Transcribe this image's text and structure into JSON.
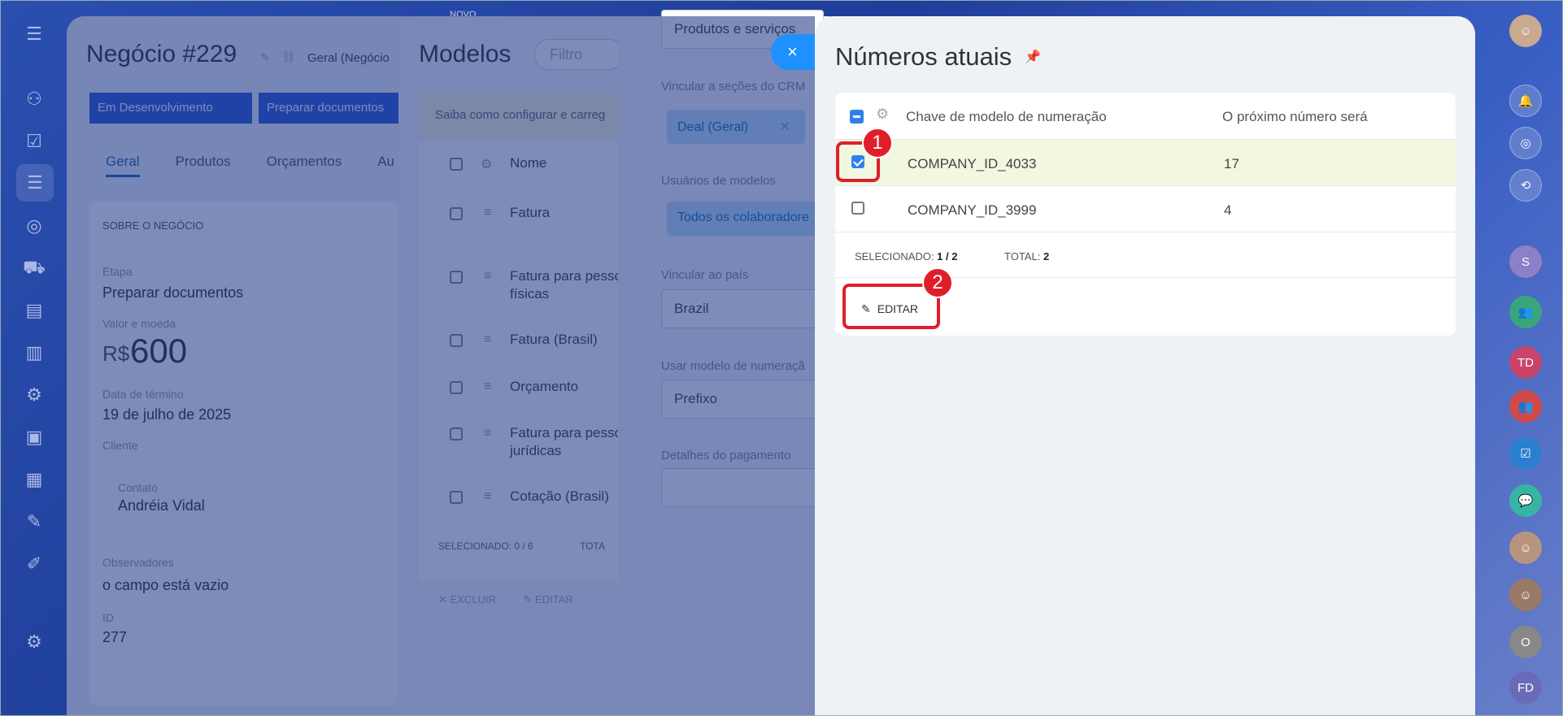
{
  "deal": {
    "title": "Negócio #229",
    "subtitle": "Geral (Negócio",
    "stages": [
      "Em Desenvolvimento",
      "Preparar documentos"
    ],
    "tabs": [
      "Geral",
      "Produtos",
      "Orçamentos",
      "Au"
    ],
    "section": "SOBRE O NEGÓCIO",
    "stage_label": "Etapa",
    "stage_value": "Preparar documentos",
    "amount_label": "Valor e moeda",
    "currency": "R$",
    "amount": "600",
    "end_label": "Data de término",
    "end_value": "19 de julho de 2025",
    "client_label": "Cliente",
    "contact_label": "Contato",
    "contact_value": "Andréia Vidal",
    "observers_label": "Observadores",
    "observers_value": "o campo está vazio",
    "id_label": "ID",
    "id_value": "277"
  },
  "models": {
    "title": "Modelos",
    "filter_placeholder": "Filtro",
    "new_label": "NOVO",
    "hint": "Saiba como configurar e carreg",
    "col_name": "Nome",
    "rows": [
      "Fatura",
      "Fatura para pesso físicas",
      "Fatura (Brasil)",
      "Orçamento",
      "Fatura para pesso jurídicas",
      "Cotação (Brasil)"
    ],
    "footer_selected": "SELECIONADO: 0 / 6",
    "footer_total": "TOTA",
    "delete_label": "EXCLUIR",
    "edit_label": "EDITAR"
  },
  "config": {
    "products_value": "Produtos e serviços",
    "link_crm_label": "Vincular a seções do CRM",
    "tag_geral": "Deal (Geral)",
    "users_label": "Usuários de modelos",
    "tag_todos": "Todos os colaboradore",
    "country_label": "Vincular ao país",
    "country_value": "Brazil",
    "numbering_label": "Usar modelo de numeraçã",
    "numbering_value": "Prefixo",
    "payment_label": "Detalhes do pagamento"
  },
  "slider": {
    "title": "Números atuais",
    "close_icon": "×",
    "columns": [
      "Chave de modelo de numeração",
      "O próximo número será"
    ],
    "rows": [
      {
        "key": "COMPANY_ID_4033",
        "next": "17",
        "checked": true
      },
      {
        "key": "COMPANY_ID_3999",
        "next": "4",
        "checked": false
      }
    ],
    "selected_label": "SELECIONADO:",
    "selected_value": "1 / 2",
    "total_label": "TOTAL:",
    "total_value": "2",
    "edit_label": "EDITAR"
  },
  "callouts": {
    "one": "1",
    "two": "2"
  },
  "rail": {
    "avatar_s": "S",
    "avatar_td": "TD",
    "avatar_o": "O",
    "avatar_fd": "FD"
  },
  "colors": {
    "accent": "#2f80ed",
    "callout": "#e01e2a",
    "selected_row": "#f1f8df"
  }
}
